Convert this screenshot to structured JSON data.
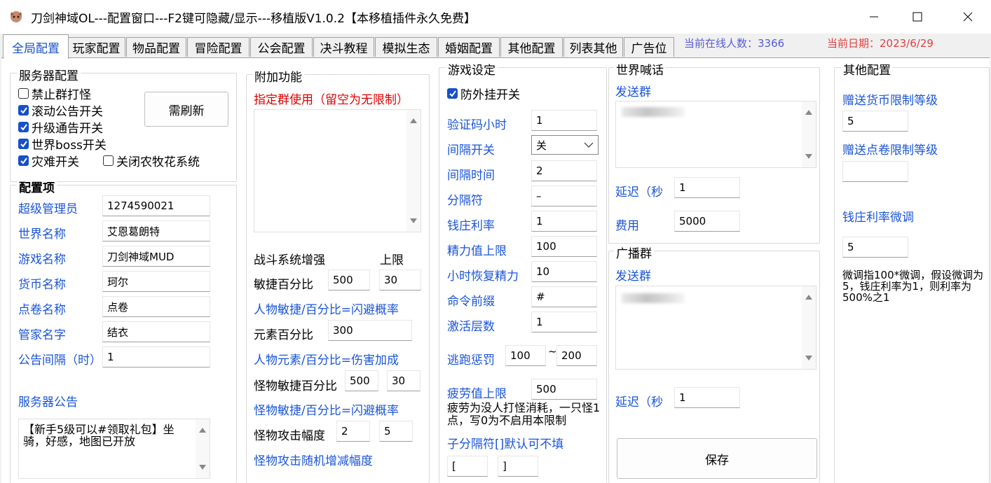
{
  "window": {
    "title": "刀剑神域OL---配置窗口---F2键可隐藏/显示---移植版V1.0.2【本移植插件永久免费】"
  },
  "tabs": [
    "全局配置",
    "玩家配置",
    "物品配置",
    "冒险配置",
    "公会配置",
    "决斗教程",
    "模拟生态",
    "婚姻配置",
    "其他配置",
    "列表其他",
    "广告位"
  ],
  "status": {
    "online": "当前在线人数：3366",
    "date": "当前日期：2023/6/29",
    "online_color": "#5a5ad6",
    "date_color": "#e04040"
  },
  "server": {
    "group_title": "服务器配置",
    "checkboxes": [
      {
        "label": "禁止群打怪",
        "checked": false
      },
      {
        "label": "滚动公告开关",
        "checked": true
      },
      {
        "label": "升级通告开关",
        "checked": true
      },
      {
        "label": "世界boss开关",
        "checked": true
      },
      {
        "label": "灾难开关",
        "checked": true
      },
      {
        "label": "关闭农牧花系统",
        "checked": false
      }
    ],
    "refresh_button": "需刷新",
    "config_title": "配置项",
    "fields": [
      {
        "label": "超级管理员",
        "value": "1274590021"
      },
      {
        "label": "世界名称",
        "value": "艾恩葛朗特"
      },
      {
        "label": "游戏名称",
        "value": "刀剑神域MUD"
      },
      {
        "label": "货币名称",
        "value": "珂尔"
      },
      {
        "label": "点卷名称",
        "value": "点卷"
      },
      {
        "label": "管家名字",
        "value": "结衣"
      },
      {
        "label": "公告间隔（时）",
        "value": "1"
      }
    ],
    "announce_label": "服务器公告",
    "announce_text": "【新手5级可以#领取礼包】坐骑，好感，地图已开放"
  },
  "extra": {
    "group_title": "附加功能",
    "group_limit": "指定群使用（留空为无限制）",
    "combat_title": "战斗系统增强",
    "limit_header": "上限",
    "agility_label": "敏捷百分比",
    "agility_value": "500",
    "agility_limit": "30",
    "agility_note": "人物敏捷/百分比=闪避概率",
    "element_label": "元素百分比",
    "element_value": "300",
    "element_note": "人物元素/百分比=伤害加成",
    "monster_agility_label": "怪物敏捷百分比",
    "monster_agility_value": "500",
    "monster_agility_limit": "30",
    "monster_agility_note": "怪物敏捷/百分比=闪避概率",
    "monster_attack_label": "怪物攻击幅度",
    "monster_attack_min": "2",
    "monster_attack_max": "5",
    "monster_attack_note": "怪物攻击随机增减幅度"
  },
  "game": {
    "group_title": "游戏设定",
    "anticheat": {
      "label": "防外挂开关",
      "checked": true
    },
    "captcha_label": "验证码小时",
    "captcha_value": "1",
    "interval_switch_label": "间隔开关",
    "interval_switch_value": "关",
    "interval_time_label": "间隔时间",
    "interval_time_value": "2",
    "separator_label": "分隔符",
    "separator_value": "–",
    "bank_rate_label": "钱庄利率",
    "bank_rate_value": "1",
    "energy_max_label": "精力值上限",
    "energy_max_value": "100",
    "energy_hour_label": "小时恢复精力",
    "energy_hour_value": "10",
    "prefix_label": "命令前缀",
    "prefix_value": "#",
    "activate_label": "激活层数",
    "activate_value": "1",
    "escape_label": "逃跑惩罚",
    "escape_min": "100",
    "escape_tilde": "~",
    "escape_max": "200",
    "fatigue_label": "疲劳值上限",
    "fatigue_value": "500",
    "fatigue_note": "疲劳为没人打怪消耗，一只怪1点，写0为不启用本限制",
    "sub_sep_label": "子分隔符[]默认可不填",
    "sub_sep_left": "[",
    "sub_sep_right": "]"
  },
  "world": {
    "group_title": "世界喊话",
    "send_group_label": "发送群",
    "delay_label": "延迟（秒",
    "delay_value": "1",
    "fee_label": "费用",
    "fee_value": "5000",
    "broadcast_title": "广播群",
    "broadcast_send_label": "发送群",
    "broadcast_delay_label": "延迟（秒",
    "broadcast_delay_value": "1",
    "save_button": "保存"
  },
  "other": {
    "group_title": "其他配置",
    "gift_currency_label": "赠送货币限制等级",
    "gift_currency_value": "5",
    "gift_point_label": "赠送点卷限制等级",
    "gift_point_value": "",
    "bank_adjust_label": "钱庄利率微调",
    "bank_adjust_value": "5",
    "bank_adjust_note": "微调指100*微调，假设微调为5，钱庄利率为1，则利率为500%之1"
  }
}
